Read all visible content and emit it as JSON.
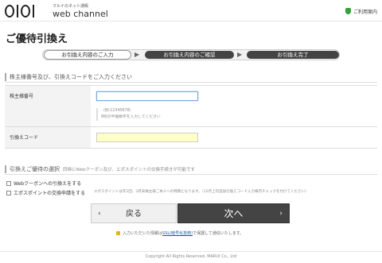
{
  "header": {
    "logo_tagline": "マルイのネット通販",
    "logo_name": "web channel",
    "help_link": "ご利用案内"
  },
  "page": {
    "title": "ご優待引換え"
  },
  "steps": [
    {
      "label": "お引換え内容のご入力",
      "active": true
    },
    {
      "label": "お引換え内容のご確認",
      "active": false
    },
    {
      "label": "お引換え完了",
      "active": false
    }
  ],
  "section1": {
    "heading": "株主様番号及び、引換えコードをご入力ください",
    "fields": {
      "shareholder_label": "株主様番号",
      "shareholder_value": "",
      "hint_example": "（例:12345678）",
      "hint_text": "8桁の半角数字を入力してください",
      "code_label": "引換えコード",
      "code_value": ""
    }
  },
  "section2": {
    "heading": "引換えご優待の選択",
    "note": "同時にWebクーポン及び、エポスポイントの交換手続きが可能です",
    "options": [
      {
        "label": "Webクーポンへの引換えをする",
        "checked": false
      },
      {
        "label": "エポスポイントの交換申請をする",
        "checked": false
      }
    ],
    "points_note": "エポスポイントは年1回、3月末株主様ご本人への特典となります。（12月上旬追加引換えコード入力毎月チェックを付けてください）"
  },
  "buttons": {
    "back": "戻る",
    "next": "次へ"
  },
  "ssl": {
    "prefix": "入力いただいた情報は",
    "link": "SSL(暗号化技術)",
    "suffix": "で保護して通信いたします。"
  },
  "footer": {
    "copyright": "Copyright All Rights Reserved. MARUI Co., Ltd"
  }
}
